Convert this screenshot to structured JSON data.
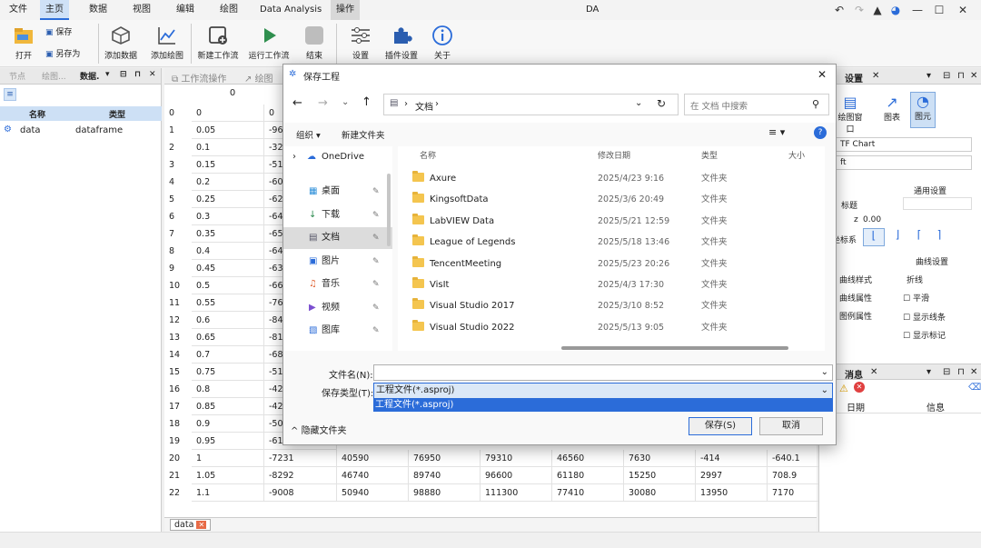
{
  "menu": {
    "items": [
      "文件",
      "主页",
      "数据",
      "视图",
      "编辑",
      "绘图",
      "Data Analysis",
      "操作"
    ],
    "app_title": "DA"
  },
  "ribbon": {
    "open": "打开",
    "save": "保存",
    "save_as": "另存为",
    "add_data": "添加数据",
    "add_plot": "添加绘图",
    "new_workflow": "新建工作流",
    "run_workflow": "运行工作流",
    "end": "结束",
    "settings": "设置",
    "plugin_settings": "插件设置",
    "about": "关于"
  },
  "left_panel": {
    "tabs": [
      "节点",
      "绘图...",
      "数据.",
      "▾",
      "⊟",
      "⊓",
      "✕"
    ],
    "columns": [
      "名称",
      "类型"
    ],
    "rows": [
      {
        "name": "data",
        "type": "dataframe"
      }
    ]
  },
  "grid": {
    "tabs": [
      "工作流操作",
      "绘图"
    ],
    "header_first": "0",
    "index_col": [
      "",
      "0",
      "1",
      "2",
      "3",
      "4",
      "5",
      "6",
      "7",
      "8",
      "9",
      "10",
      "11",
      "12",
      "13",
      "14",
      "15",
      "16",
      "17",
      "18",
      "19",
      "20",
      "21",
      "22"
    ],
    "col0": [
      "0",
      "0.05",
      "0.1",
      "0.15",
      "0.2",
      "0.25",
      "0.3",
      "0.35",
      "0.4",
      "0.45",
      "0.5",
      "0.55",
      "0.6",
      "0.65",
      "0.7",
      "0.75",
      "0.8",
      "0.85",
      "0.9",
      "0.95",
      "1",
      "1.05",
      "1.1"
    ],
    "col1": [
      "0",
      "-96",
      "-32",
      "-51",
      "-60",
      "-62",
      "-64",
      "-65",
      "-64",
      "-63",
      "-66",
      "-76",
      "-84",
      "-81",
      "-68",
      "-51",
      "-42",
      "-42",
      "-50",
      "-61",
      "-7231",
      "-8292",
      "-9008"
    ],
    "rows_visible": [
      [
        "40590",
        "76950",
        "79310",
        "46560",
        "7630",
        "-414",
        "-640.1"
      ],
      [
        "46740",
        "89740",
        "96600",
        "61180",
        "15250",
        "2997",
        "708.9"
      ],
      [
        "50940",
        "98880",
        "111300",
        "77410",
        "30080",
        "13950",
        "7170"
      ]
    ],
    "sheet_tab": "data"
  },
  "right_panel": {
    "tab_settings": "设置",
    "icons": [
      "绘图窗口",
      "图表",
      "图元"
    ],
    "field1": "TF Chart",
    "field2": "ft",
    "general_settings": "通用设置",
    "title_label": "标题",
    "z_label": "z",
    "z_value": "0.00",
    "coord_label": "坐标系",
    "curve_settings": "曲线设置",
    "curve_style_label": "曲线样式",
    "curve_style_value": "折线",
    "curve_attr_label": "曲线属性",
    "smooth": "平滑",
    "legend_attr_label": "图例属性",
    "show_line": "显示线条",
    "show_marker": "显示标记",
    "msg_tab": "消息",
    "msg_cols": [
      "日期",
      "信息"
    ]
  },
  "dialog": {
    "title": "保存工程",
    "path": [
      "文档"
    ],
    "search_placeholder": "在 文档 中搜索",
    "organize": "组织 ▾",
    "new_folder": "新建文件夹",
    "tree": [
      {
        "label": "OneDrive",
        "pin": false
      },
      {
        "label": "桌面",
        "pin": true
      },
      {
        "label": "下载",
        "pin": true
      },
      {
        "label": "文档",
        "pin": true
      },
      {
        "label": "图片",
        "pin": true
      },
      {
        "label": "音乐",
        "pin": true
      },
      {
        "label": "视频",
        "pin": true
      },
      {
        "label": "图库",
        "pin": true
      }
    ],
    "columns": [
      "名称",
      "修改日期",
      "类型",
      "大小"
    ],
    "files": [
      {
        "name": "Axure",
        "date": "2025/4/23 9:16",
        "type": "文件夹"
      },
      {
        "name": "KingsoftData",
        "date": "2025/3/6 20:49",
        "type": "文件夹"
      },
      {
        "name": "LabVIEW Data",
        "date": "2025/5/21 12:59",
        "type": "文件夹"
      },
      {
        "name": "League of Legends",
        "date": "2025/5/18 13:46",
        "type": "文件夹"
      },
      {
        "name": "TencentMeeting",
        "date": "2025/5/23 20:26",
        "type": "文件夹"
      },
      {
        "name": "VisIt",
        "date": "2025/4/3 17:30",
        "type": "文件夹"
      },
      {
        "name": "Visual Studio 2017",
        "date": "2025/3/10 8:52",
        "type": "文件夹"
      },
      {
        "name": "Visual Studio 2022",
        "date": "2025/5/13 9:05",
        "type": "文件夹"
      }
    ],
    "filename_label": "文件名(N):",
    "filename_value": "",
    "filetype_label": "保存类型(T):",
    "filetype_value": "工程文件(*.asproj)",
    "filetype_option": "工程文件(*.asproj)",
    "hide_folders": "隐藏文件夹",
    "save": "保存(S)",
    "cancel": "取消"
  }
}
